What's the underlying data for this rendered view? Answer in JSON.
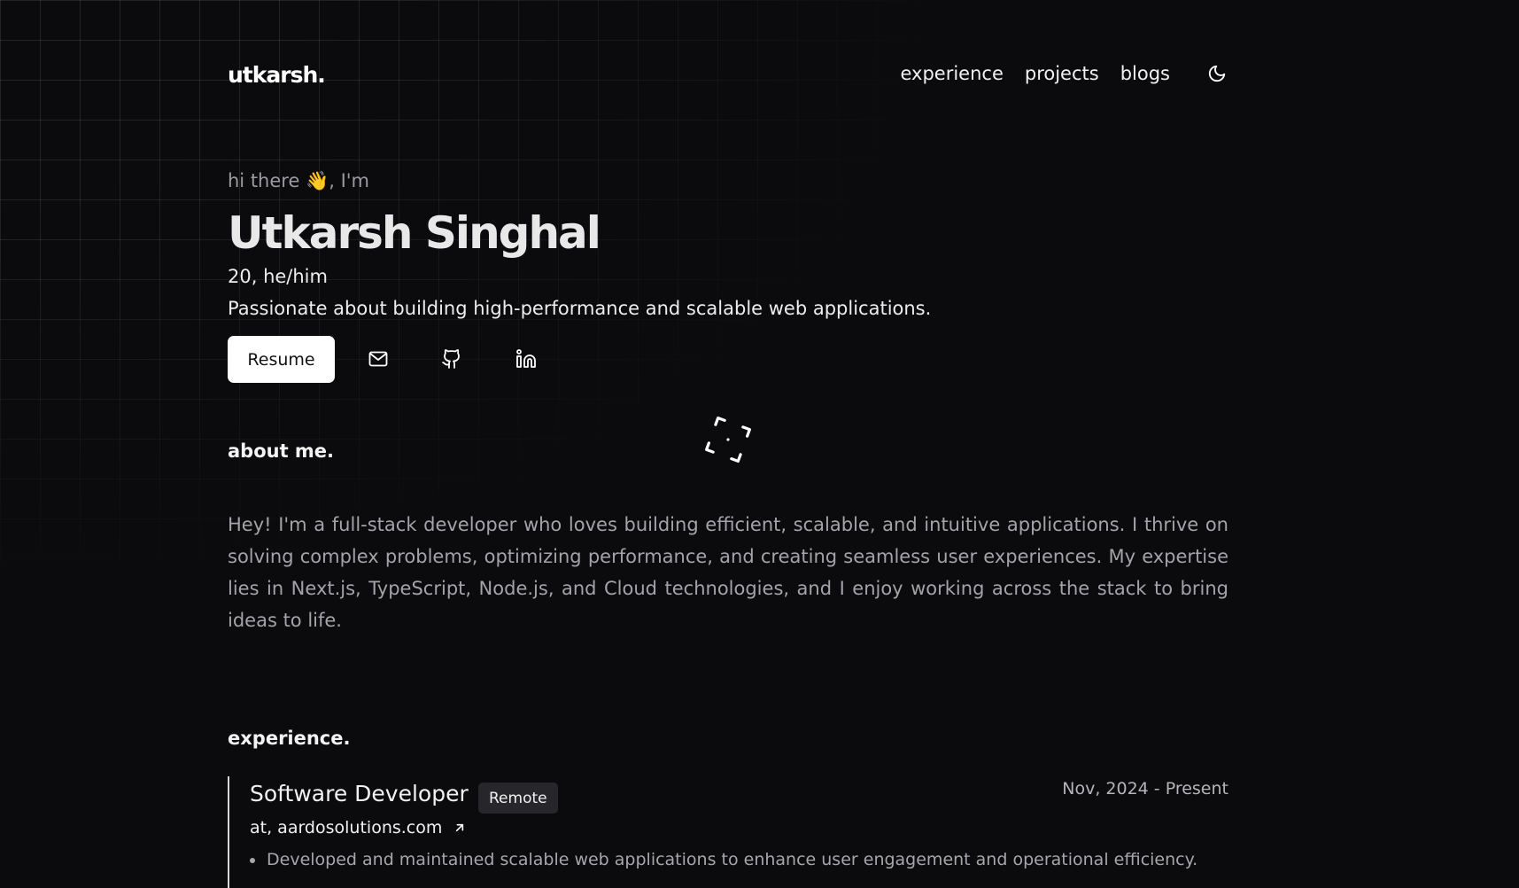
{
  "header": {
    "logo": "utkarsh.",
    "nav": [
      {
        "label": "experience"
      },
      {
        "label": "projects"
      },
      {
        "label": "blogs"
      }
    ],
    "theme_toggle_icon": "moon-icon"
  },
  "hero": {
    "greeting_prefix": "hi there",
    "greeting_emoji": "👋",
    "greeting_suffix": ", I'm",
    "name": "Utkarsh Singhal",
    "age_pronouns": "20, he/him",
    "tagline": "Passionate about building high-performance and scalable web applications.",
    "resume_label": "Resume",
    "social_icons": [
      "mail-icon",
      "github-icon",
      "linkedin-icon"
    ]
  },
  "about": {
    "title": "about me.",
    "text": "Hey! I'm a full-stack developer who loves building efficient, scalable, and intuitive applications. I thrive on solving complex problems, optimizing performance, and creating seamless user experiences. My expertise lies in Next.js, TypeScript, Node.js, and Cloud technologies, and I enjoy working across the stack to bring ideas to life."
  },
  "experience": {
    "title": "experience.",
    "items": [
      {
        "role": "Software Developer",
        "badge": "Remote",
        "date": "Nov, 2024 - Present",
        "company": "at, aardosolutions.com",
        "bullets": [
          "Developed and maintained scalable web applications to enhance user engagement and operational efficiency."
        ]
      }
    ]
  },
  "colors": {
    "background": "#0b0b0e",
    "text_primary": "#ececec",
    "text_muted": "#a3a3a8",
    "button_bg": "#ffffff",
    "badge_bg": "#27272b"
  }
}
